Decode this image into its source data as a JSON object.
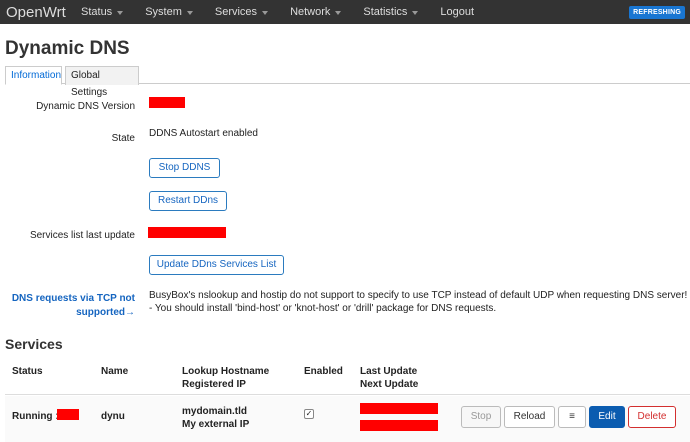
{
  "navbar": {
    "brand": "OpenWrt",
    "menu": [
      {
        "label": "Status"
      },
      {
        "label": "System"
      },
      {
        "label": "Services"
      },
      {
        "label": "Network"
      },
      {
        "label": "Statistics"
      }
    ],
    "logout": "Logout",
    "badge": "REFRESHING"
  },
  "page": {
    "title": "Dynamic DNS",
    "tabs": [
      "Information",
      "Global Settings"
    ]
  },
  "info": {
    "version_label": "Dynamic DNS Version",
    "state_label": "State",
    "state_value": "DDNS Autostart enabled",
    "stop_button": "Stop DDNS",
    "restart_button": "Restart DDns",
    "services_update_label": "Services list last update",
    "update_button": "Update DDns Services List",
    "tcp_label_line1": "DNS requests via TCP not",
    "tcp_label_line2": "supported",
    "tcp_arrow": "→",
    "tcp_text_line1": "BusyBox's nslookup and hostip do not support to specify to use TCP instead of default UDP when requesting DNS server!",
    "tcp_text_line2": "- You should install 'bind-host' or 'knot-host' or 'drill' package for DNS requests."
  },
  "services": {
    "title": "Services",
    "headers": {
      "status": "Status",
      "name": "Name",
      "lookup": "Lookup Hostname",
      "registered": "Registered IP",
      "enabled": "Enabled",
      "last_update": "Last Update",
      "next_update": "Next Update"
    },
    "rows": [
      {
        "status": "Running :",
        "name": "dynu",
        "hostname": "mydomain.tld",
        "registered_ip": "My external IP",
        "enabled": true,
        "enabled_mark": "✓"
      }
    ],
    "actions": {
      "stop": "Stop",
      "reload": "Reload",
      "menu": "≡",
      "edit": "Edit",
      "delete": "Delete"
    }
  },
  "colors": {
    "navbar": "#333333",
    "accent": "#1565c0",
    "badge": "#1976d2",
    "redaction": "#ff0000",
    "delete": "#d32f2f"
  }
}
